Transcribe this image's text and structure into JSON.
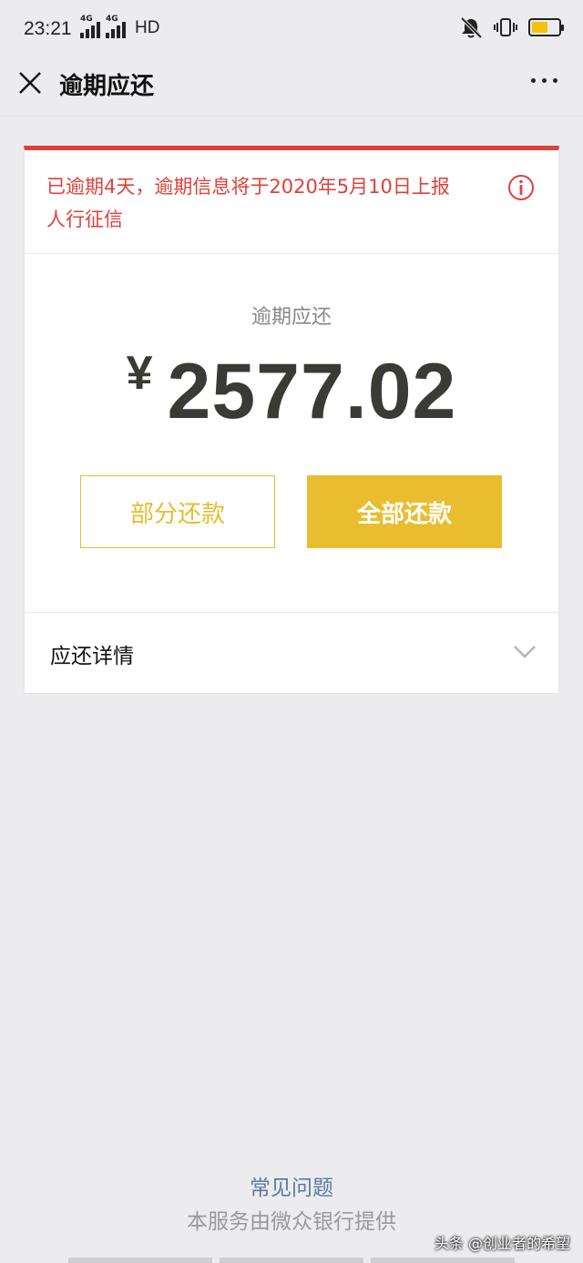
{
  "status_bar": {
    "time": "23:21",
    "network_label_1": "4G",
    "network_label_2": "4G",
    "hd_label": "HD",
    "battery_color": "#f4c20d",
    "icons": [
      "mute-icon",
      "vibrate-icon",
      "battery-icon"
    ]
  },
  "nav": {
    "title": "逾期应还",
    "close_icon": "close-icon",
    "more_icon": "more-icon"
  },
  "alert": {
    "text_line_1": "已逾期4天，逾期信息将于2020年5月10日上报",
    "text_line_2": "人行征信",
    "color": "#e0403a",
    "icon": "info-icon"
  },
  "overdue": {
    "label": "逾期应还",
    "currency": "¥",
    "amount": "2577.02"
  },
  "buttons": {
    "partial_label": "部分还款",
    "full_label": "全部还款",
    "accent_color": "#e9bd2d"
  },
  "details": {
    "label": "应还详情",
    "icon": "chevron-down-icon"
  },
  "footer": {
    "faq": "常见问题",
    "provider": "本服务由微众银行提供"
  },
  "watermark": "头条 @创业者的希望"
}
